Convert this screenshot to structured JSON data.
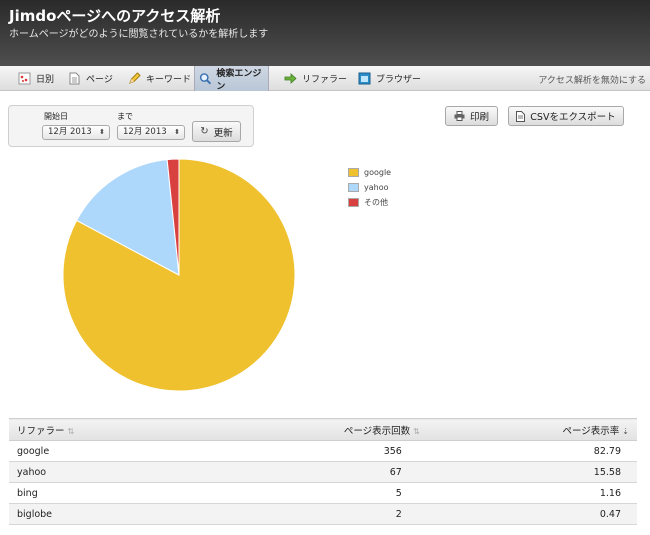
{
  "header": {
    "title": "Jimdoページへのアクセス解析",
    "subtitle": "ホームページがどのように閲覧されているかを解析します"
  },
  "tabs": [
    {
      "label": "日別",
      "icon": "calendar-icon"
    },
    {
      "label": "ページ",
      "icon": "page-icon"
    },
    {
      "label": "キーワード",
      "icon": "pencil-icon"
    },
    {
      "label": "検索エンジン",
      "icon": "magnifier-icon",
      "active": true
    },
    {
      "label": "リファラー",
      "icon": "arrow-icon"
    },
    {
      "label": "ブラウザー",
      "icon": "browser-icon"
    }
  ],
  "disable_link": "アクセス解析を無効にする",
  "filter": {
    "start_label": "開始日",
    "end_label": "まで",
    "start_value": "12月 2013",
    "end_value": "12月 2013",
    "refresh_label": "更新"
  },
  "actions": {
    "print_label": "印刷",
    "csv_label": "CSVをエクスポート"
  },
  "chart_data": {
    "type": "pie",
    "slices": [
      {
        "label": "google",
        "value": 82.79,
        "color": "#efc12f"
      },
      {
        "label": "yahoo",
        "value": 15.58,
        "color": "#aed8fb"
      },
      {
        "label": "その他",
        "value": 1.63,
        "color": "#d94141"
      }
    ]
  },
  "table": {
    "headers": [
      "リファラー",
      "ページ表示回数",
      "ページ表示率"
    ],
    "rows": [
      [
        "google",
        "356",
        "82.79"
      ],
      [
        "yahoo",
        "67",
        "15.58"
      ],
      [
        "bing",
        "5",
        "1.16"
      ],
      [
        "biglobe",
        "2",
        "0.47"
      ]
    ]
  }
}
